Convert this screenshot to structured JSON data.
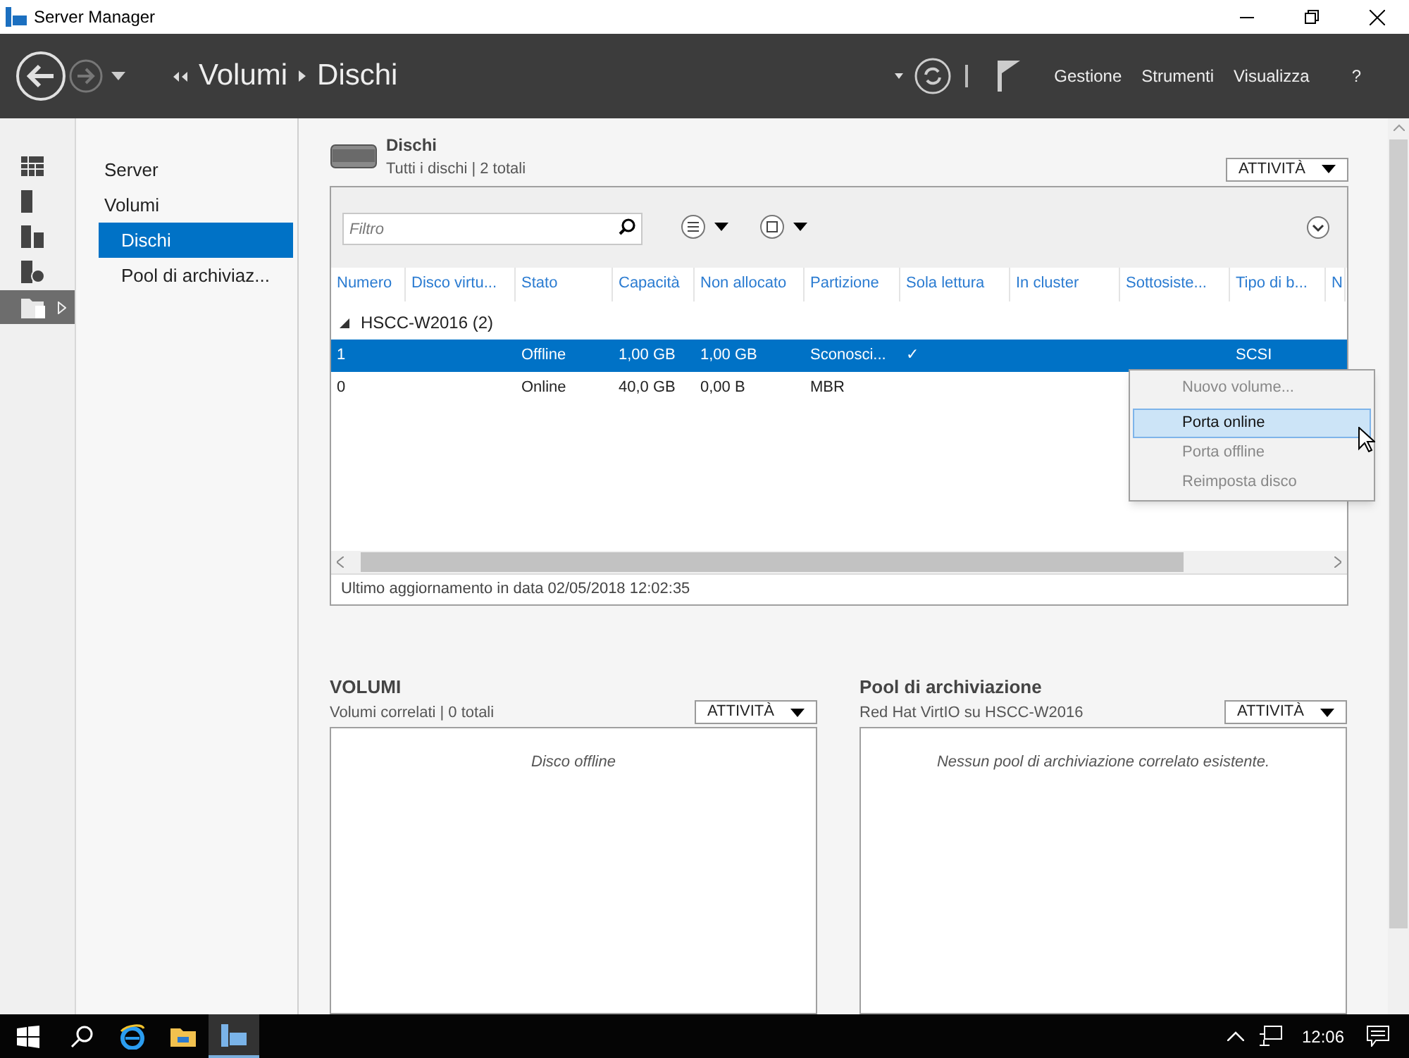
{
  "window": {
    "title": "Server Manager"
  },
  "header": {
    "breadcrumb": [
      "Volumi",
      "Dischi"
    ],
    "menu": [
      "Gestione",
      "Strumenti",
      "Visualizza",
      "?"
    ]
  },
  "icon_bar": [
    {
      "kind": "dashboard",
      "selected": false
    },
    {
      "kind": "server",
      "selected": false
    },
    {
      "kind": "servers",
      "selected": false
    },
    {
      "kind": "file",
      "selected": false
    },
    {
      "kind": "storage",
      "selected": true
    }
  ],
  "nav": [
    {
      "label": "Server",
      "selected": false
    },
    {
      "label": "Volumi",
      "selected": false,
      "children": [
        {
          "label": "Dischi",
          "selected": true
        },
        {
          "label": "Pool di archiviaz...",
          "selected": false
        }
      ]
    }
  ],
  "disks_panel": {
    "title": "Dischi",
    "subtitle": "Tutti i dischi | 2 totali",
    "tasks": "ATTIVITÀ",
    "filter_placeholder": "Filtro",
    "columns": [
      "Numero",
      "Disco virtu...",
      "Stato",
      "Capacità",
      "Non allocato",
      "Partizione",
      "Sola lettura",
      "In cluster",
      "Sottosiste...",
      "Tipo di b...",
      "N"
    ],
    "group": {
      "label": "HSCC-W2016 (2)",
      "expanded": true
    },
    "rows": [
      {
        "selected": true,
        "cells": [
          "1",
          null,
          "Offline",
          "1,00 GB",
          "1,00 GB",
          "Sconosci...",
          "✓",
          null,
          null,
          "SCSI",
          null
        ]
      },
      {
        "selected": false,
        "cells": [
          "0",
          null,
          "Online",
          "40,0 GB",
          "0,00 B",
          "MBR",
          null,
          null,
          null,
          null,
          null
        ]
      }
    ],
    "footer": "Ultimo aggiornamento in data 02/05/2018 12:02:35"
  },
  "context_menu": [
    {
      "label": "Nuovo volume...",
      "disabled": true,
      "selected": false
    },
    {
      "label": "Porta online",
      "disabled": false,
      "selected": true
    },
    {
      "label": "Porta offline",
      "disabled": true,
      "selected": false
    },
    {
      "label": "Reimposta disco",
      "disabled": true,
      "selected": false
    }
  ],
  "volumes_panel": {
    "title": "VOLUMI",
    "subtitle": "Volumi correlati | 0 totali",
    "tasks": "ATTIVITÀ",
    "message": "Disco offline"
  },
  "pools_panel": {
    "title": "Pool di archiviazione",
    "subtitle": "Red Hat VirtIO su HSCC-W2016",
    "tasks": "ATTIVITÀ",
    "message": "Nessun pool di archiviazione correlato esistente."
  },
  "taskbar": {
    "clock": "12:06"
  }
}
